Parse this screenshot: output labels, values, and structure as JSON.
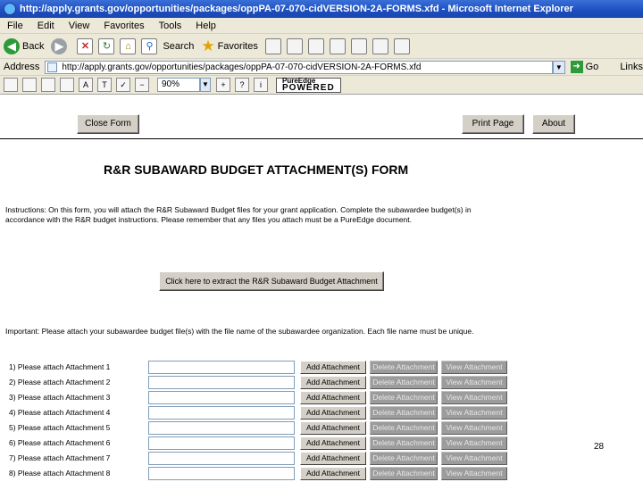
{
  "window": {
    "title": "http://apply.grants.gov/opportunities/packages/oppPA-07-070-cidVERSION-2A-FORMS.xfd - Microsoft Internet Explorer"
  },
  "menu": [
    "File",
    "Edit",
    "View",
    "Favorites",
    "Tools",
    "Help"
  ],
  "toolbar": {
    "back_label": "Back",
    "search_label": "Search",
    "favorites_label": "Favorites"
  },
  "address": {
    "label": "Address",
    "url": "http://apply.grants.gov/opportunities/packages/oppPA-07-070-cidVERSION-2A-FORMS.xfd",
    "go_label": "Go",
    "links_label": "Links"
  },
  "adobe": {
    "zoom": "90%",
    "powered_top": "PureEdge",
    "powered_bottom": "POWERED"
  },
  "form": {
    "close_label": "Close Form",
    "print_label": "Print Page",
    "about_label": "About",
    "title": "R&R SUBAWARD BUDGET ATTACHMENT(S) FORM",
    "instructions": "Instructions:  On this form, you will attach the R&R Subaward Budget files for your grant application.  Complete the subawardee budget(s) in accordance with the R&R budget instructions.  Please remember that any files you attach must be a PureEdge document.",
    "extract_label": "Click here to extract the R&R Subaward Budget Attachment",
    "important": "Important:  Please attach your subawardee budget file(s) with the file name of the subawardee organization.  Each file name must be unique.",
    "add_label": "Add Attachment",
    "delete_label": "Delete Attachment",
    "view_label": "View Attachment",
    "attachments": [
      "1) Please attach Attachment 1",
      "2) Please attach Attachment 2",
      "3) Please attach Attachment 3",
      "4) Please attach Attachment 4",
      "5) Please attach Attachment 5",
      "6) Please attach Attachment 6",
      "7) Please attach Attachment 7",
      "8) Please attach Attachment 8"
    ]
  },
  "page_number": "28"
}
